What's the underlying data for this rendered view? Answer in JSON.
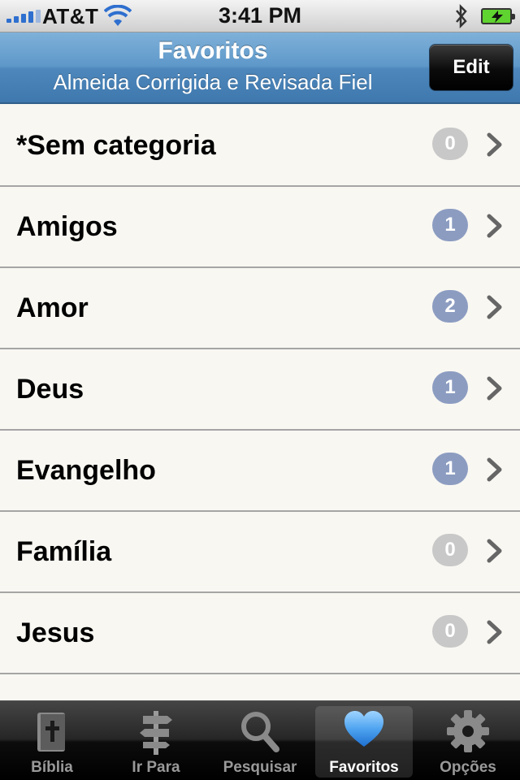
{
  "status_bar": {
    "carrier": "AT&T",
    "time": "3:41 PM"
  },
  "nav": {
    "title": "Favoritos",
    "subtitle": "Almeida Corrigida e Revisada Fiel",
    "edit_label": "Edit"
  },
  "colors": {
    "badge_active": "#8c9cc1",
    "badge_empty": "#c8c8c8",
    "nav_blue": "#5e98c9"
  },
  "list": {
    "items": [
      {
        "label": "*Sem categoria",
        "count": "0"
      },
      {
        "label": "Amigos",
        "count": "1"
      },
      {
        "label": "Amor",
        "count": "2"
      },
      {
        "label": "Deus",
        "count": "1"
      },
      {
        "label": "Evangelho",
        "count": "1"
      },
      {
        "label": "Família",
        "count": "0"
      },
      {
        "label": "Jesus",
        "count": "0"
      }
    ]
  },
  "tabs": [
    {
      "label": "Bíblia",
      "icon": "bible-icon"
    },
    {
      "label": "Ir Para",
      "icon": "signpost-icon"
    },
    {
      "label": "Pesquisar",
      "icon": "search-icon"
    },
    {
      "label": "Favoritos",
      "icon": "heart-icon",
      "selected": true
    },
    {
      "label": "Opções",
      "icon": "gear-icon"
    }
  ]
}
